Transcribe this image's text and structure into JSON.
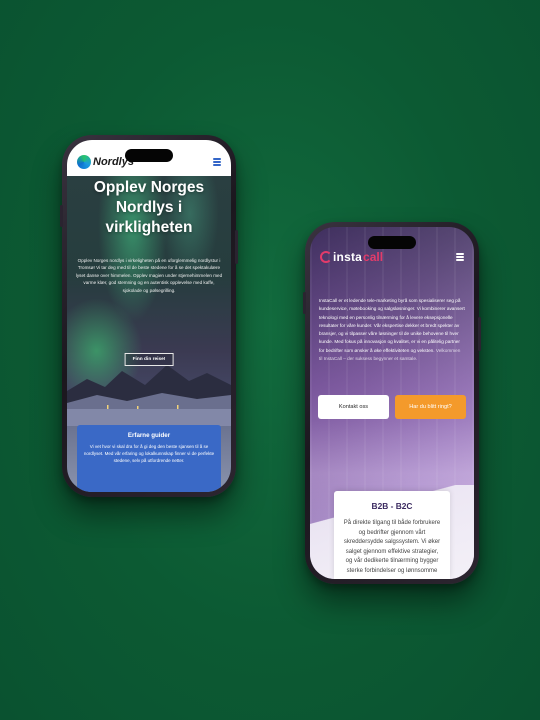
{
  "phone1": {
    "brand": "Nordlys",
    "hero": {
      "title": "Opplev Norges Nordlys i virkligheten",
      "text": "Opplev Norges nordlys i virkeligheten på en uforglemmelig nordlystur i Tromsø! Vi tar deg med til de beste stedene for å se det spektakulære lyset danse over himmelen. Opplev magien under stjernehimmelen med varme klær, god stemning og en autentisk opplevelse med kaffe, sjokolade og pølsegrilling.",
      "button": "Finn din reise!"
    },
    "card": {
      "title": "Erfarne guider",
      "text": "Vi vet hvor vi skal dra for å gi deg den beste sjansen til å se nordlyset. Med vår erfaring og lokalkunnskap finner vi de perfekte stedene, selv på utfordrende netter."
    }
  },
  "phone2": {
    "brand_a": "insta",
    "brand_b": "call",
    "intro": "InstaCall er et ledende tele-marketing byrå som spesialiserer seg på kundeservice, møtebooking og salgsløsninger. Vi kombinerer avansert teknologi med en personlig tilnærming for å levere eksepsjonelle resultater for våre kunder. Vår ekspertise dekker et bredt spekter av bransjer, og vi tilpasser våre løsninger til de unike behovene til hver kunde. Med fokus på innovasjon og kvalitet, er vi en pålitelig partner for bedrifter som ønsker å øke effektiviteten og veksten.",
    "intro_end": "Velkommen til InstaCall – der suksess begynner et samtale.",
    "buttons": {
      "contact": "Kontakt oss",
      "call": "Har du blitt ringt?"
    },
    "card": {
      "title": "B2B - B2C",
      "text": "På direkte tilgang til både forbrukere og bedrifter gjennom vårt skreddersydde salgssystem. Vi øker salget gjennom effektive strategier, og vår dedikerte tilnærming bygger sterke forbindelser og lønnsomme"
    }
  }
}
